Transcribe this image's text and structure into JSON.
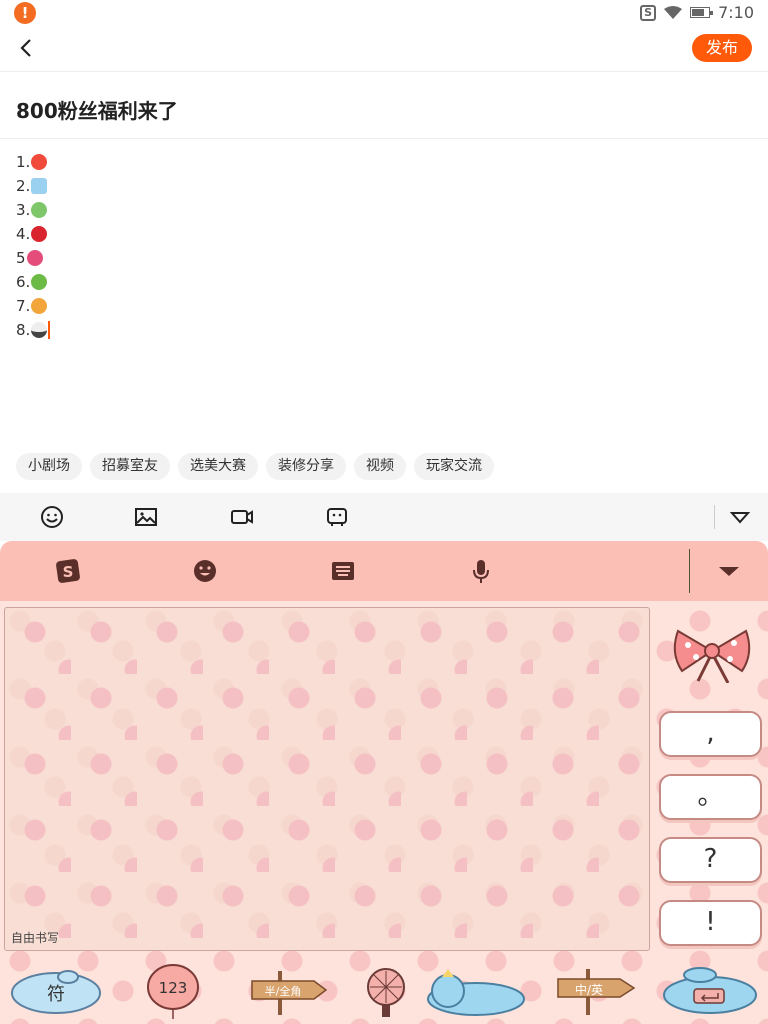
{
  "status": {
    "time": "7:10"
  },
  "nav": {
    "publish_label": "发布"
  },
  "post": {
    "title": "800粉丝福利来了",
    "lines": [
      {
        "prefix": "1.",
        "emoji_color": "#f04a3a"
      },
      {
        "prefix": "2.",
        "emoji_color": "#9ad0f0"
      },
      {
        "prefix": "3.",
        "emoji_color": "#7dc66a"
      },
      {
        "prefix": "4.",
        "emoji_color": "#d9232e"
      },
      {
        "prefix": "5",
        "emoji_color": "#e44d7a"
      },
      {
        "prefix": "6.",
        "emoji_color": "#6dbb47"
      },
      {
        "prefix": "7.",
        "emoji_color": "#f2a53a"
      },
      {
        "prefix": "8.",
        "emoji_color": "#444444"
      }
    ]
  },
  "tags": [
    "小剧场",
    "招募室友",
    "选美大赛",
    "装修分享",
    "视频",
    "玩家交流"
  ],
  "keyboard": {
    "handwriting_label": "自由书写",
    "punctuation": [
      ",",
      "。",
      "?",
      "!"
    ],
    "bottom": {
      "symbols_label": "符",
      "numbers_label": "123",
      "half_full_label": "半/全角",
      "cn_en_label": "中/英"
    }
  },
  "colors": {
    "accent": "#ff5a0a",
    "ime_bar": "#fcbfb6",
    "ime_bg": "#fde3dc"
  }
}
